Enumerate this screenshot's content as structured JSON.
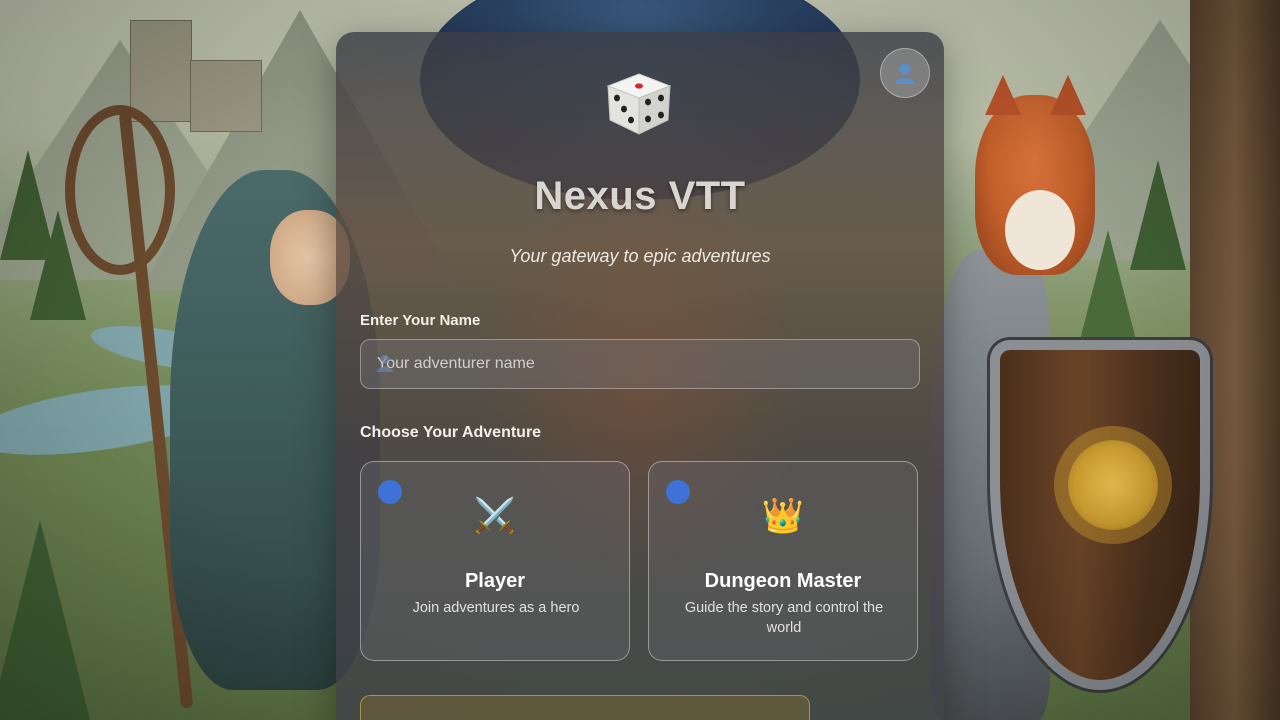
{
  "app": {
    "title": "Nexus VTT",
    "subtitle": "Your gateway to epic adventures"
  },
  "header": {
    "logo_icon": "dice-icon",
    "profile_icon": "user-silhouette-icon"
  },
  "name_section": {
    "label": "Enter Your Name",
    "placeholder": "Your adventurer name",
    "value": "",
    "icon": "user-icon"
  },
  "adventure_section": {
    "label": "Choose Your Adventure",
    "options": [
      {
        "title": "Player",
        "description": "Join adventures as a hero",
        "icon": "crossed-swords-icon",
        "glyph": "⚔️"
      },
      {
        "title": "Dungeon Master",
        "description": "Guide the story and control the world",
        "icon": "crown-icon",
        "glyph": "👑"
      }
    ]
  },
  "colors": {
    "accent": "#3f72d6",
    "title": "#d9d6d2",
    "panel": "#4a4548",
    "gold_border": "#c8aa50"
  }
}
